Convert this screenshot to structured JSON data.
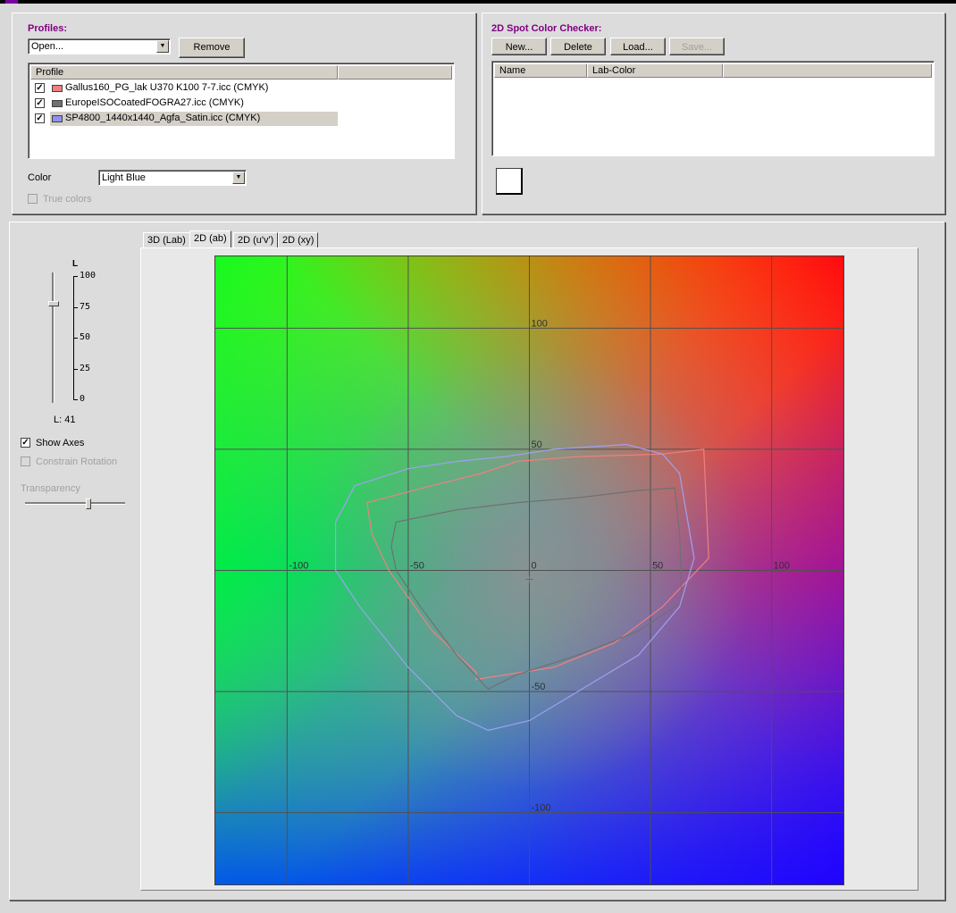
{
  "profiles_panel": {
    "title": "Profiles:",
    "open_combo": "Open...",
    "remove_label": "Remove",
    "list_header": "Profile",
    "items": [
      {
        "label": "Gallus160_PG_lak U370 K100 7-7.icc (CMYK)",
        "checked": true,
        "color": "#f08080"
      },
      {
        "label": "EuropeISOCoatedFOGRA27.icc (CMYK)",
        "checked": true,
        "color": "#707070"
      },
      {
        "label": "SP4800_1440x1440_Agfa_Satin.icc (CMYK)",
        "checked": true,
        "color": "#9090f0"
      }
    ],
    "color_label": "Color",
    "color_value": "Light Blue",
    "true_colors_label": "True colors"
  },
  "spot_panel": {
    "title": "2D Spot Color Checker:",
    "new_label": "New...",
    "delete_label": "Delete",
    "load_label": "Load...",
    "save_label": "Save...",
    "col_name": "Name",
    "col_lab": "Lab-Color"
  },
  "controls": {
    "l_axis_label": "L",
    "l_ticks": [
      "100",
      "75",
      "50",
      "25",
      "0"
    ],
    "l_value_text": "L: 41",
    "l_value": 41,
    "show_axes_label": "Show Axes",
    "show_axes_checked": true,
    "constrain_label": "Constrain Rotation",
    "transparency_label": "Transparency",
    "transparency_level": 0.6
  },
  "tabs": [
    "3D (Lab)",
    "2D (ab)",
    "2D (u'v')",
    "2D (xy)"
  ],
  "active_tab": "2D (ab)",
  "plot": {
    "a_range": [
      -130,
      130
    ],
    "b_range": [
      -130,
      130
    ],
    "a_tick_labels": [
      {
        "value": -100,
        "text": "-100"
      },
      {
        "value": -50,
        "text": "-50"
      },
      {
        "value": 0,
        "text": "0"
      },
      {
        "value": 50,
        "text": "50"
      },
      {
        "value": 100,
        "text": "100"
      }
    ],
    "b_tick_labels": [
      {
        "value": 100,
        "text": "100"
      },
      {
        "value": 50,
        "text": "50"
      },
      {
        "value": -50,
        "text": "-50"
      },
      {
        "value": -100,
        "text": "-100"
      }
    ],
    "gamuts": [
      {
        "profile": "Gallus160_PG_lak U370 K100 7-7.icc (CMYK)",
        "color": "#f08080",
        "points": [
          [
            -67,
            28
          ],
          [
            -40,
            35
          ],
          [
            -20,
            40
          ],
          [
            -5,
            45
          ],
          [
            20,
            47
          ],
          [
            55,
            48
          ],
          [
            72,
            50
          ],
          [
            74,
            5
          ],
          [
            55,
            -15
          ],
          [
            35,
            -30
          ],
          [
            10,
            -40
          ],
          [
            -22,
            -45
          ],
          [
            -22,
            -42
          ],
          [
            -40,
            -25
          ],
          [
            -58,
            0
          ],
          [
            -65,
            15
          ]
        ]
      },
      {
        "profile": "EuropeISOCoatedFOGRA27.icc (CMYK)",
        "color": "#707070",
        "points": [
          [
            -55,
            20
          ],
          [
            -30,
            25
          ],
          [
            -5,
            28
          ],
          [
            20,
            30
          ],
          [
            45,
            33
          ],
          [
            60,
            34
          ],
          [
            62,
            15
          ],
          [
            63,
            -13
          ],
          [
            45,
            -25
          ],
          [
            20,
            -35
          ],
          [
            -5,
            -43
          ],
          [
            -17,
            -49
          ],
          [
            -30,
            -35
          ],
          [
            -45,
            -15
          ],
          [
            -55,
            0
          ],
          [
            -57,
            10
          ]
        ]
      },
      {
        "profile": "SP4800_1440x1440_Agfa_Satin.icc (CMYK)",
        "color": "#a0a0f0",
        "points": [
          [
            -72,
            35
          ],
          [
            -50,
            42
          ],
          [
            -30,
            45
          ],
          [
            -10,
            47
          ],
          [
            10,
            50
          ],
          [
            40,
            52
          ],
          [
            55,
            48
          ],
          [
            62,
            40
          ],
          [
            68,
            5
          ],
          [
            62,
            -15
          ],
          [
            45,
            -35
          ],
          [
            20,
            -50
          ],
          [
            0,
            -62
          ],
          [
            -17,
            -66
          ],
          [
            -30,
            -60
          ],
          [
            -50,
            -40
          ],
          [
            -70,
            -15
          ],
          [
            -80,
            0
          ],
          [
            -80,
            20
          ]
        ]
      }
    ]
  }
}
